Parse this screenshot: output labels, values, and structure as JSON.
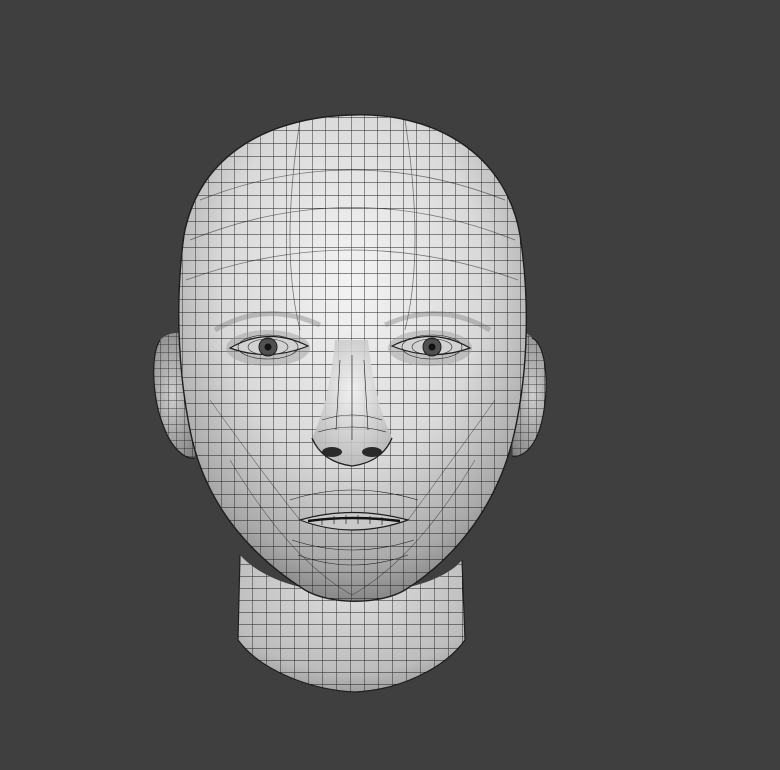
{
  "viewport": {
    "background_color": "#3f3f3f"
  },
  "model": {
    "subject": "head",
    "view": "front",
    "display_mode": "wireframe-on-shaded",
    "surface_color": "#e6e6e6",
    "wire_color": "#1e1e1e"
  }
}
